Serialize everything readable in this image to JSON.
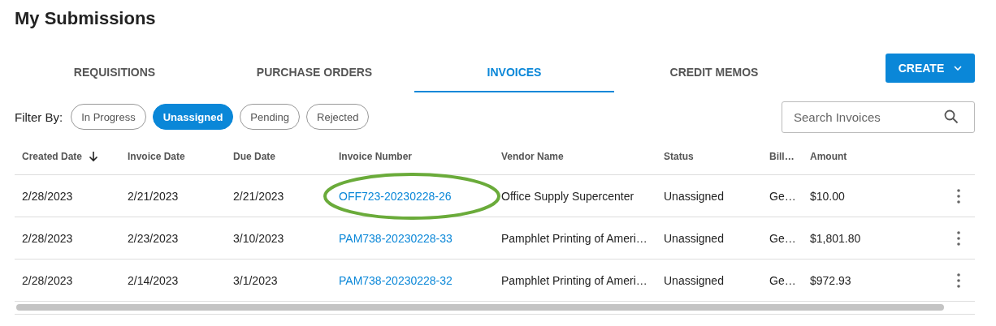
{
  "title": "My Submissions",
  "tabs": [
    {
      "label": "REQUISITIONS",
      "selected": false
    },
    {
      "label": "PURCHASE ORDERS",
      "selected": false
    },
    {
      "label": "INVOICES",
      "selected": true
    },
    {
      "label": "CREDIT MEMOS",
      "selected": false
    }
  ],
  "create_button": {
    "label": "CREATE"
  },
  "filter": {
    "label": "Filter By:",
    "chips": [
      {
        "label": "In Progress",
        "selected": false
      },
      {
        "label": "Unassigned",
        "selected": true
      },
      {
        "label": "Pending",
        "selected": false
      },
      {
        "label": "Rejected",
        "selected": false
      }
    ]
  },
  "search": {
    "placeholder": "Search Invoices"
  },
  "table": {
    "columns": [
      {
        "label": "Created Date",
        "sorted": true
      },
      {
        "label": "Invoice Date",
        "sorted": false
      },
      {
        "label": "Due Date",
        "sorted": false
      },
      {
        "label": "Invoice Number",
        "sorted": false
      },
      {
        "label": "Vendor Name",
        "sorted": false
      },
      {
        "label": "Status",
        "sorted": false
      },
      {
        "label": "Bill…",
        "sorted": false
      },
      {
        "label": "Amount",
        "sorted": false
      }
    ],
    "rows": [
      {
        "cells": [
          "2/28/2023",
          "2/21/2023",
          "2/21/2023",
          "OFF723-20230228-26",
          "Office Supply Supercenter",
          "Unassigned",
          "Ge…",
          "$10.00"
        ],
        "circled": true
      },
      {
        "cells": [
          "2/28/2023",
          "2/23/2023",
          "3/10/2023",
          "PAM738-20230228-33",
          "Pamphlet Printing of Ameri…",
          "Unassigned",
          "Ge…",
          "$1,801.80"
        ],
        "circled": false
      },
      {
        "cells": [
          "2/28/2023",
          "2/14/2023",
          "3/1/2023",
          "PAM738-20230228-32",
          "Pamphlet Printing of Ameri…",
          "Unassigned",
          "Ge…",
          "$972.93"
        ],
        "circled": false
      }
    ]
  }
}
